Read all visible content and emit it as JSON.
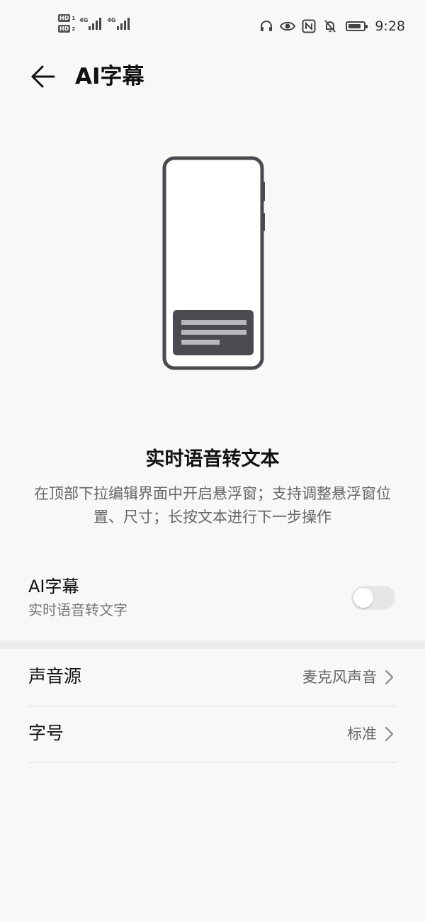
{
  "status_bar": {
    "sim1_badge": "HD",
    "sim1_num": "1",
    "sim2_badge": "HD",
    "sim2_num": "2",
    "net1_label": "4G",
    "net2_label": "4G",
    "battery_level": 0.85,
    "time": "9:28",
    "icons": [
      "headset-icon",
      "eye-icon",
      "nfc-icon",
      "bell-off-icon",
      "battery-icon"
    ]
  },
  "header": {
    "back_icon": "arrow-left-icon",
    "title": "AI字幕"
  },
  "illustration": {
    "icon": "phone-floating-caption-illustration"
  },
  "feature": {
    "title": "实时语音转文本",
    "description": "在顶部下拉编辑界面中开启悬浮窗；支持调整悬浮窗位置、尺寸；长按文本进行下一步操作"
  },
  "toggle": {
    "title": "AI字幕",
    "subtitle": "实时语音转文字",
    "enabled": false
  },
  "settings": {
    "rows": [
      {
        "label": "声音源",
        "value": "麦克风声音",
        "icon": "chevron-right-icon"
      },
      {
        "label": "字号",
        "value": "标准",
        "icon": "chevron-right-icon"
      }
    ]
  },
  "colors": {
    "background": "#f8f8f8",
    "illustration_stroke": "#4a4a50",
    "switch_off": "#e6e6e6"
  }
}
